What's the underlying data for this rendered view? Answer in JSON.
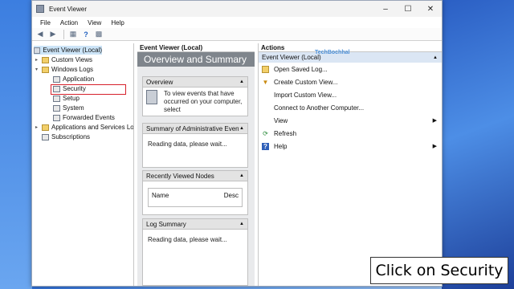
{
  "window": {
    "title": "Event Viewer"
  },
  "menu": [
    "File",
    "Action",
    "View",
    "Help"
  ],
  "tree": {
    "root": "Event Viewer (Local)",
    "items": [
      {
        "label": "Custom Views",
        "kind": "folder"
      },
      {
        "label": "Windows Logs",
        "kind": "folder"
      },
      {
        "label": "Application",
        "kind": "log"
      },
      {
        "label": "Security",
        "kind": "log"
      },
      {
        "label": "Setup",
        "kind": "log"
      },
      {
        "label": "System",
        "kind": "log"
      },
      {
        "label": "Forwarded Events",
        "kind": "log"
      },
      {
        "label": "Applications and Services Lo",
        "kind": "folder"
      },
      {
        "label": "Subscriptions",
        "kind": "log"
      }
    ]
  },
  "middle": {
    "header": "Event Viewer (Local)",
    "banner": "Overview and Summary",
    "overview": {
      "title": "Overview",
      "text": "To view events that have occurred on your computer, select"
    },
    "admin": {
      "title": "Summary of Administrative Events",
      "text": "Reading data, please wait..."
    },
    "recent": {
      "title": "Recently Viewed Nodes",
      "col1": "Name",
      "col2": "Desc"
    },
    "logsummary": {
      "title": "Log Summary",
      "text": "Reading data, please wait..."
    }
  },
  "actions": {
    "header": "Actions",
    "section": "Event Viewer (Local)",
    "watermark": "TechBochhal",
    "items": [
      {
        "label": "Open Saved Log...",
        "icon": "folder-icon",
        "submenu": false
      },
      {
        "label": "Create Custom View...",
        "icon": "filter-icon",
        "submenu": false
      },
      {
        "label": "Import Custom View...",
        "icon": "",
        "submenu": false
      },
      {
        "label": "Connect to Another Computer...",
        "icon": "",
        "submenu": false
      },
      {
        "label": "View",
        "icon": "",
        "submenu": true
      },
      {
        "label": "Refresh",
        "icon": "refresh-icon",
        "submenu": false
      },
      {
        "label": "Help",
        "icon": "help-icon",
        "submenu": true
      }
    ]
  },
  "caption": "Click on Security",
  "colors": {
    "highlight": "#d6212b",
    "banner": "#7f858c",
    "selection": "#cce4f7"
  }
}
